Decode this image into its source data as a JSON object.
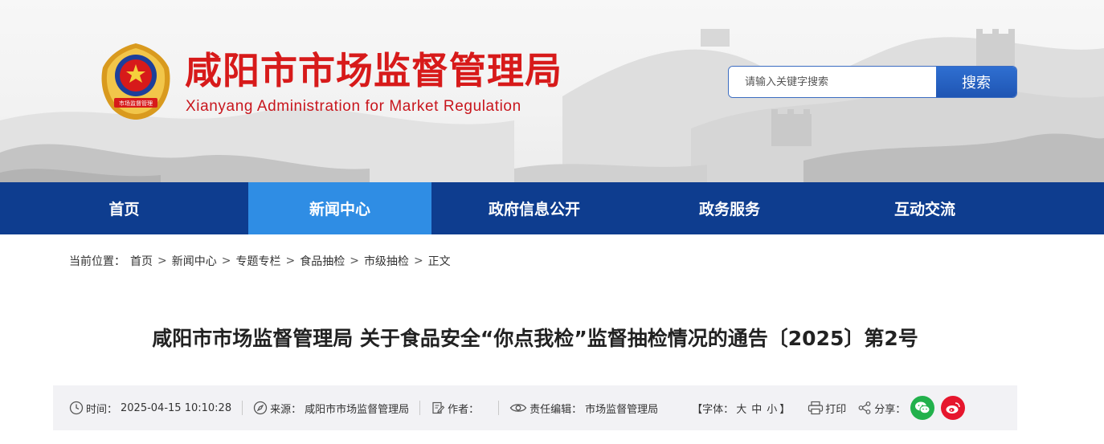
{
  "header": {
    "title_cn": "咸阳市市场监督管理局",
    "title_en": "Xianyang Administration for Market Regulation",
    "emblem_text": "市场监督管理",
    "search_placeholder": "请输入关键字搜索",
    "search_button": "搜索",
    "brand_red": "#d71a1a"
  },
  "nav": {
    "items": [
      {
        "label": "首页"
      },
      {
        "label": "新闻中心"
      },
      {
        "label": "政府信息公开"
      },
      {
        "label": "政务服务"
      },
      {
        "label": "互动交流"
      }
    ],
    "active_index": 1,
    "bg_color": "#0e3d8f",
    "active_color": "#2f8de4"
  },
  "breadcrumb": {
    "prefix": "当前位置：",
    "items": [
      "首页",
      "新闻中心",
      "专题专栏",
      "食品抽检",
      "市级抽检",
      "正文"
    ],
    "separator": ">"
  },
  "article": {
    "title": "咸阳市市场监督管理局 关于食品安全“你点我检”监督抽检情况的通告〔2025〕第2号",
    "meta": {
      "time_label": "时间：",
      "time_value": "2025-04-15 10:10:28",
      "source_label": "来源：",
      "source_value": "咸阳市市场监督管理局",
      "author_label": "作者：",
      "author_value": "",
      "editor_label": "责任编辑：",
      "editor_value": "市场监督管理局",
      "font_label_open": "【字体：",
      "font_large": "大",
      "font_medium": "中",
      "font_small": "小",
      "font_label_close": "】",
      "print_label": "打印",
      "share_label": "分享："
    }
  },
  "icons": [
    "clock-icon",
    "compass-icon",
    "edit-icon",
    "eye-icon",
    "print-icon",
    "share-icon",
    "wechat-icon",
    "weibo-icon"
  ]
}
